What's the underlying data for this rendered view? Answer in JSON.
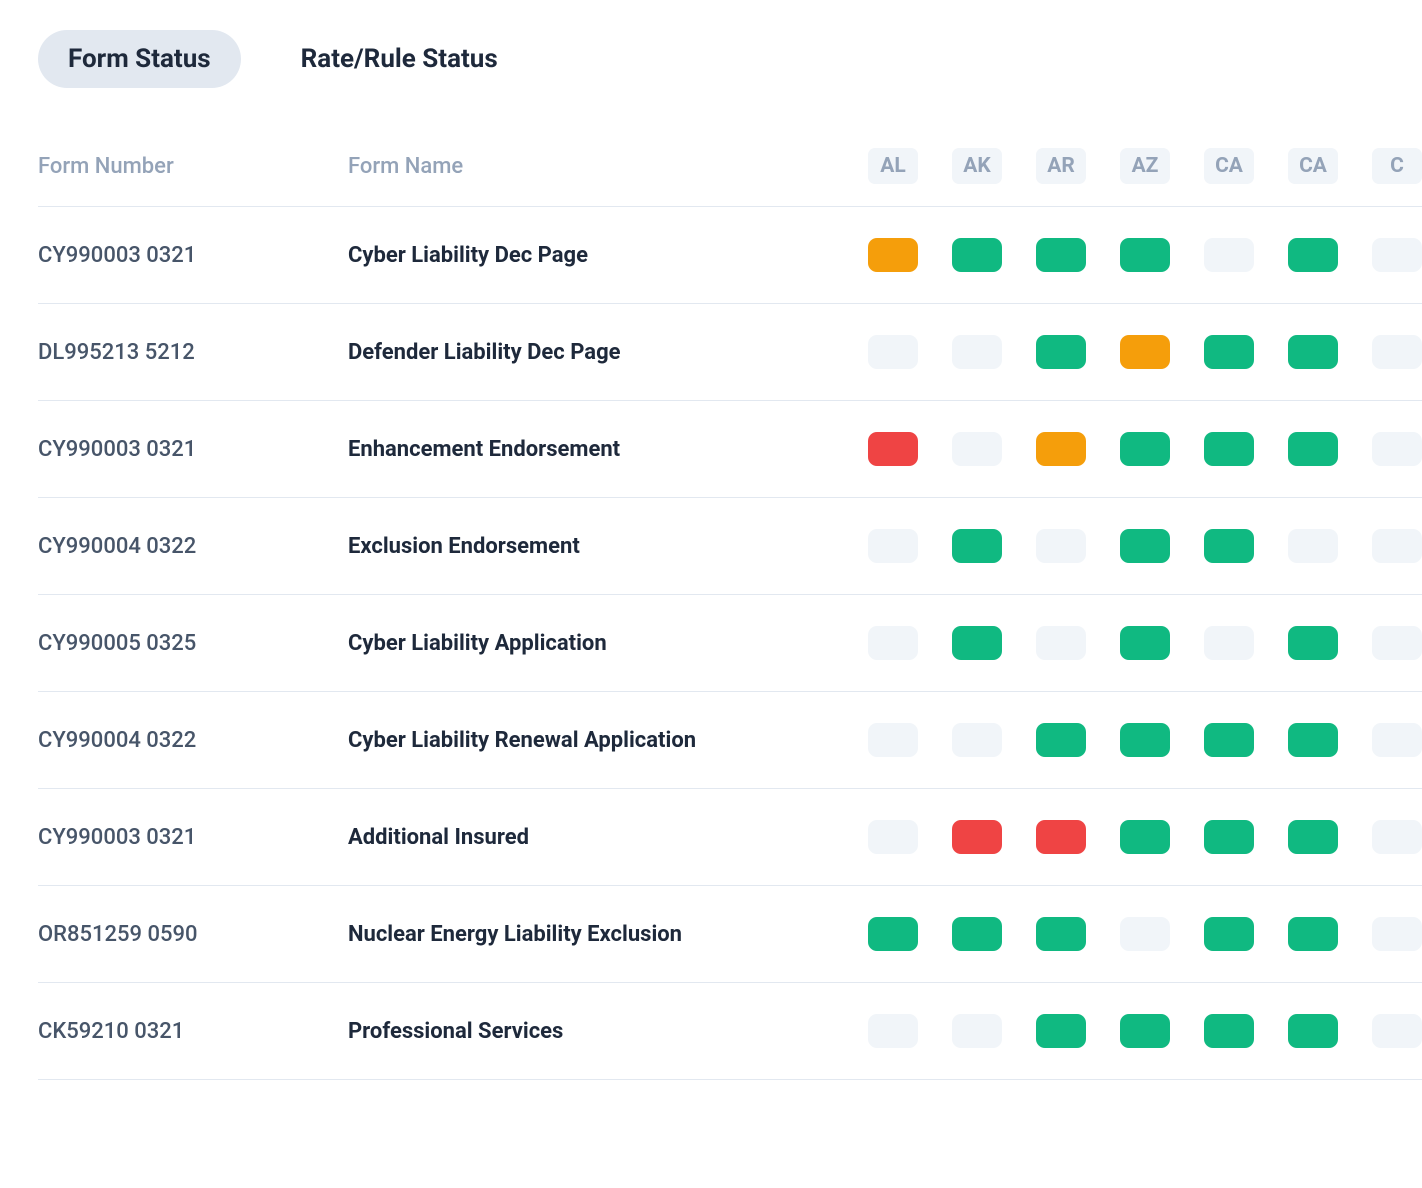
{
  "tabs": [
    {
      "label": "Form Status",
      "active": true
    },
    {
      "label": "Rate/Rule Status",
      "active": false
    }
  ],
  "columns": {
    "form_number": "Form Number",
    "form_name": "Form Name"
  },
  "states": [
    "AL",
    "AK",
    "AR",
    "AZ",
    "CA",
    "CA",
    "C"
  ],
  "colors": {
    "green": "#10b981",
    "orange": "#f59e0b",
    "red": "#ef4444",
    "gray": "#f1f5f9"
  },
  "rows": [
    {
      "form_number": "CY990003 0321",
      "form_name": "Cyber Liability Dec Page",
      "statuses": [
        "orange",
        "green",
        "green",
        "green",
        "gray",
        "green",
        "gray"
      ]
    },
    {
      "form_number": "DL995213 5212",
      "form_name": "Defender Liability Dec Page",
      "statuses": [
        "gray",
        "gray",
        "green",
        "orange",
        "green",
        "green",
        "gray"
      ]
    },
    {
      "form_number": "CY990003 0321",
      "form_name": "Enhancement Endorsement",
      "statuses": [
        "red",
        "gray",
        "orange",
        "green",
        "green",
        "green",
        "gray"
      ]
    },
    {
      "form_number": "CY990004 0322",
      "form_name": "Exclusion Endorsement",
      "statuses": [
        "gray",
        "green",
        "gray",
        "green",
        "green",
        "gray",
        "gray"
      ]
    },
    {
      "form_number": "CY990005 0325",
      "form_name": "Cyber Liability Application",
      "statuses": [
        "gray",
        "green",
        "gray",
        "green",
        "gray",
        "green",
        "gray"
      ]
    },
    {
      "form_number": "CY990004 0322",
      "form_name": "Cyber Liability Renewal Application",
      "statuses": [
        "gray",
        "gray",
        "green",
        "green",
        "green",
        "green",
        "gray"
      ]
    },
    {
      "form_number": "CY990003 0321",
      "form_name": "Additional Insured",
      "statuses": [
        "gray",
        "red",
        "red",
        "green",
        "green",
        "green",
        "gray"
      ]
    },
    {
      "form_number": "OR851259 0590",
      "form_name": "Nuclear Energy Liability Exclusion",
      "statuses": [
        "green",
        "green",
        "green",
        "gray",
        "green",
        "green",
        "gray"
      ]
    },
    {
      "form_number": "CK59210 0321",
      "form_name": "Professional Services",
      "statuses": [
        "gray",
        "gray",
        "green",
        "green",
        "green",
        "green",
        "gray"
      ]
    }
  ]
}
